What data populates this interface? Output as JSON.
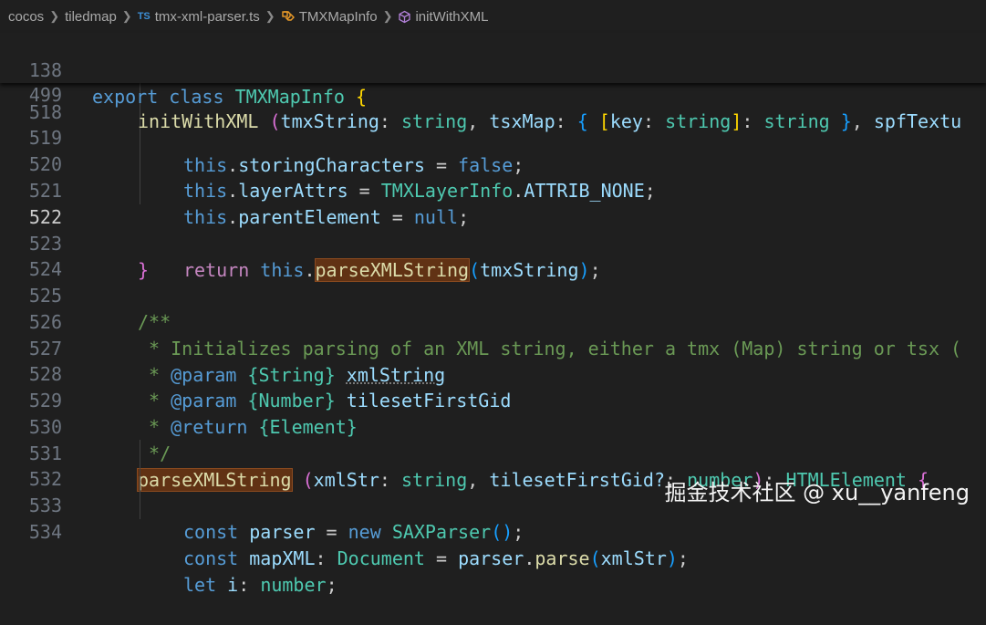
{
  "breadcrumb": {
    "items": [
      "cocos",
      "tiledmap",
      "tmx-xml-parser.ts",
      "TMXMapInfo",
      "initWithXML"
    ],
    "file_badge": "TS"
  },
  "editor": {
    "active_line": "522",
    "sticky": [
      {
        "ln": "138"
      },
      {
        "ln": "499"
      }
    ],
    "lines": [
      {
        "ln": "518"
      },
      {
        "ln": "519"
      },
      {
        "ln": "520"
      },
      {
        "ln": "521"
      },
      {
        "ln": "522"
      },
      {
        "ln": "523"
      },
      {
        "ln": "524"
      },
      {
        "ln": "525"
      },
      {
        "ln": "526"
      },
      {
        "ln": "527"
      },
      {
        "ln": "528"
      },
      {
        "ln": "529"
      },
      {
        "ln": "530"
      },
      {
        "ln": "531"
      },
      {
        "ln": "532"
      },
      {
        "ln": "533"
      },
      {
        "ln": "534"
      }
    ],
    "tokens": {
      "s138_export": "export",
      "s138_class": "class",
      "s138_name": "TMXMapInfo",
      "s138_brace": "{",
      "s499_fn": "initWithXML",
      "s499_p1": "tmxString",
      "s499_t1": "string",
      "s499_p2": "tsxMap",
      "s499_k": "key",
      "s499_t2": "string",
      "s499_t3": "string",
      "s499_p3": "spfTextu",
      "l518_this": "this",
      "l518_prop": "storingCharacters",
      "l518_val": "false",
      "l519_this": "this",
      "l519_prop": "layerAttrs",
      "l519_cls": "TMXLayerInfo",
      "l519_const": "ATTRIB_NONE",
      "l520_this": "this",
      "l520_prop": "parentElement",
      "l520_val": "null",
      "l522_return": "return",
      "l522_this": "this",
      "l522_fn": "parseXMLString",
      "l522_arg": "tmxString",
      "l523_brace": "}",
      "l525_open": "/**",
      "l526_text": " * Initializes parsing of an XML string, either a tmx (Map) string or tsx (",
      "l527_star": " * ",
      "l527_tag": "@param",
      "l527_type": "{String}",
      "l527_name": "xmlString",
      "l528_star": " * ",
      "l528_tag": "@param",
      "l528_type": "{Number}",
      "l528_name": "tilesetFirstGid",
      "l529_star": " * ",
      "l529_tag": "@return",
      "l529_type": "{Element}",
      "l530_close": " */",
      "l531_fn": "parseXMLString",
      "l531_p1": "xmlStr",
      "l531_t1": "string",
      "l531_p2": "tilesetFirstGid?",
      "l531_t2": "number",
      "l531_ret": "HTMLElement",
      "l532_const": "const",
      "l532_var": "parser",
      "l532_new": "new",
      "l532_cls": "SAXParser",
      "l533_const": "const",
      "l533_var": "mapXML",
      "l533_type": "Document",
      "l533_obj": "parser",
      "l533_fn": "parse",
      "l533_arg": "xmlStr",
      "l534_let": "let",
      "l534_var": "i",
      "l534_type": "number"
    }
  },
  "watermark": "掘金技术社区 @ xu__yanfeng",
  "colors": {
    "background": "#1f1f1f",
    "highlight": "#613214",
    "keyword": "#569cd6",
    "class": "#4ec9b0",
    "function": "#dcdcaa",
    "comment": "#6a9955"
  }
}
